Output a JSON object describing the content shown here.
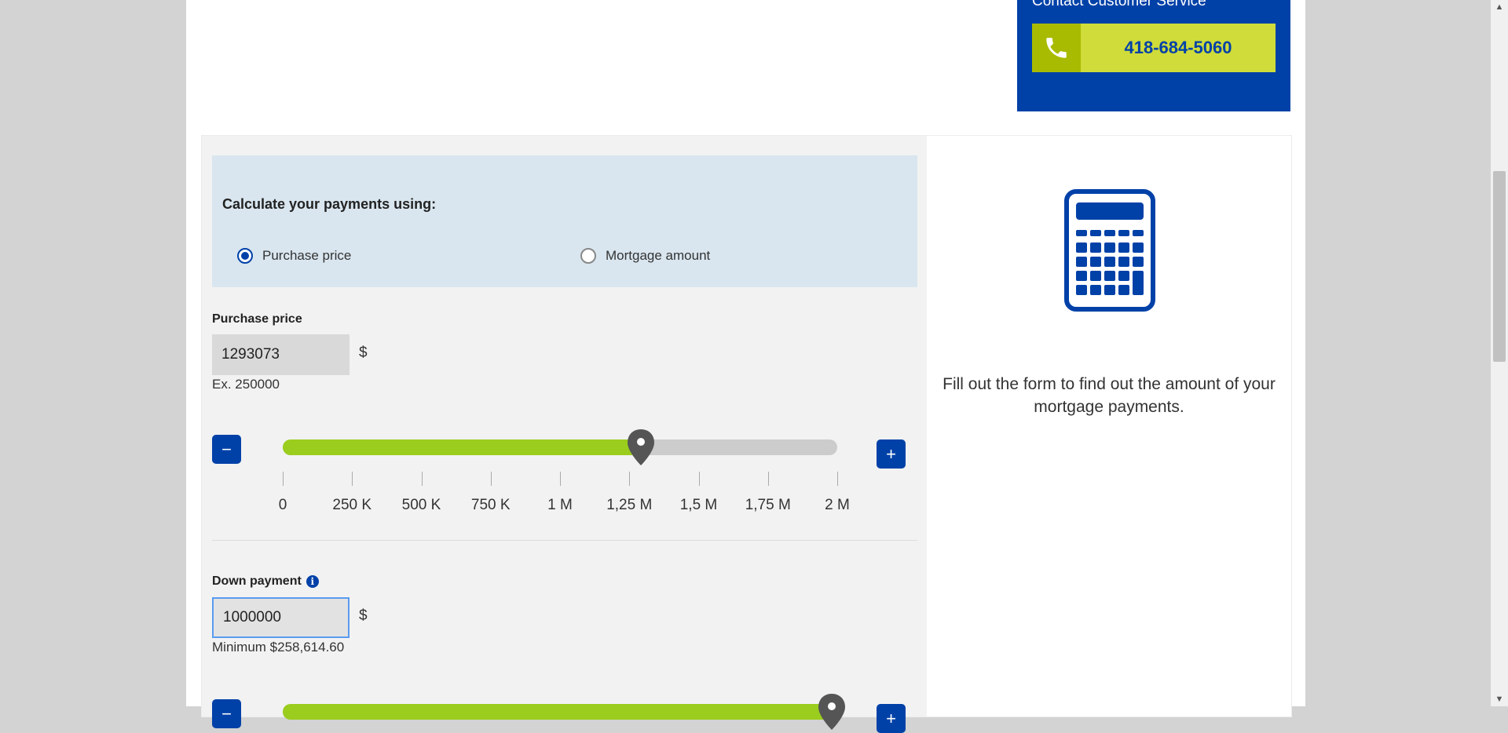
{
  "contact": {
    "title": "Contact Customer Service",
    "phone": "418-684-5060",
    "colors": {
      "panel": "#0041a8",
      "button": "#cfdc3a",
      "icon_bg": "#a8bb00"
    }
  },
  "calculator": {
    "mode_title": "Calculate your payments using:",
    "modes": [
      {
        "label": "Purchase price",
        "checked": true
      },
      {
        "label": "Mortgage amount",
        "checked": false
      }
    ],
    "purchase_price": {
      "label": "Purchase price",
      "value": "1293073",
      "unit": "$",
      "helper": "Ex. 250000",
      "slider": {
        "min": 0,
        "max": 2000000,
        "value": 1293073,
        "ticks": [
          "0",
          "250 K",
          "500 K",
          "750 K",
          "1 M",
          "1,25 M",
          "1,5 M",
          "1,75 M",
          "2 M"
        ]
      },
      "minus_label": "−",
      "plus_label": "+"
    },
    "down_payment": {
      "label": "Down payment",
      "info_icon": "i",
      "value": "1000000",
      "unit": "$",
      "helper": "Minimum $258,614.60",
      "slider": {
        "fill_fraction": 0.99
      },
      "minus_label": "−",
      "plus_label": "+"
    },
    "accent_color": "#0041a8",
    "slider_fill_color": "#9acd1e"
  },
  "result": {
    "icon": "calculator-icon",
    "message": "Fill out the form to find out the amount of your mortgage payments."
  }
}
